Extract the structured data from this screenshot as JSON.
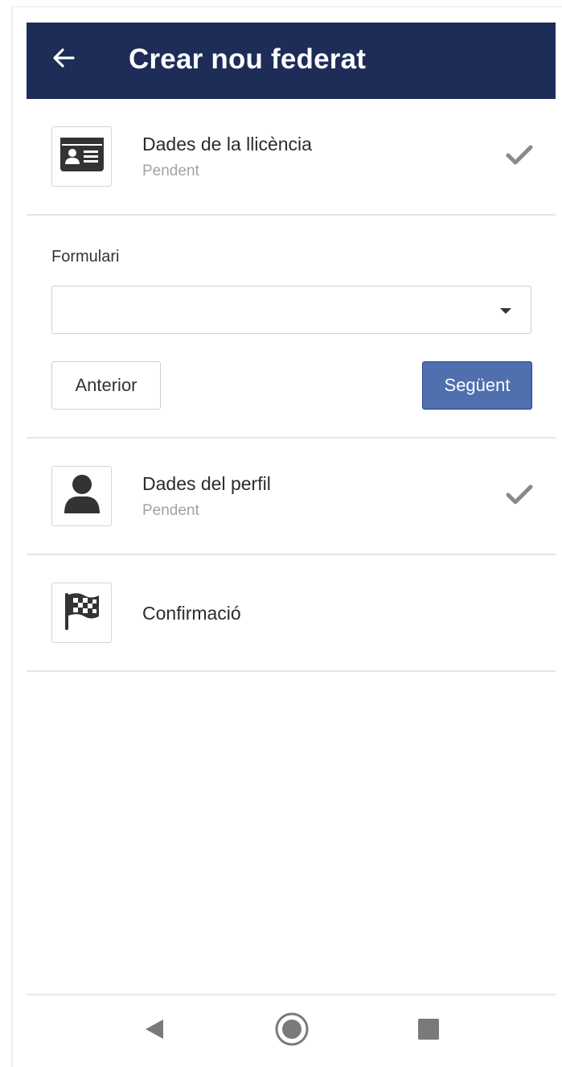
{
  "app_bar": {
    "title": "Crear nou federat",
    "back_icon": "arrow-left-icon",
    "background_color": "#1e2c58"
  },
  "steps": [
    {
      "title": "Dades de la llicència",
      "status": "Pendent",
      "icon": "id-card-icon",
      "completed_icon": "check-icon"
    },
    {
      "title": "Dades del perfil",
      "status": "Pendent",
      "icon": "user-icon",
      "completed_icon": "check-icon"
    },
    {
      "title": "Confirmació",
      "icon": "checkered-flag-icon"
    }
  ],
  "form": {
    "label": "Formulari",
    "selected_value": "",
    "caret_icon": "caret-down-icon"
  },
  "buttons": {
    "previous": "Anterior",
    "next": "Següent",
    "next_color": "#4f6fae"
  },
  "system_nav": {
    "back_icon": "nav-back-triangle-icon",
    "home_icon": "nav-home-circle-icon",
    "recents_icon": "nav-recents-square-icon"
  }
}
